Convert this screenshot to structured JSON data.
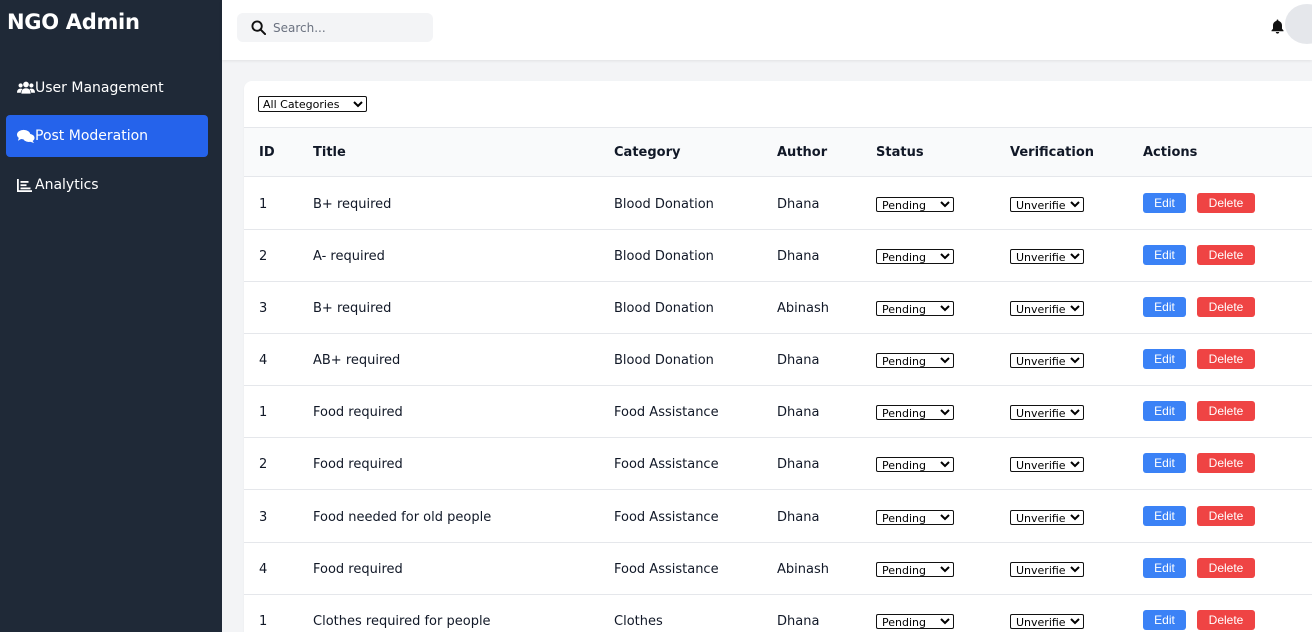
{
  "app": {
    "title": "NGO Admin"
  },
  "sidebar": {
    "items": [
      {
        "label": "User Management",
        "icon": "users-icon",
        "active": false
      },
      {
        "label": "Post Moderation",
        "icon": "comments-icon",
        "active": true
      },
      {
        "label": "Analytics",
        "icon": "chart-icon",
        "active": false
      }
    ]
  },
  "topbar": {
    "search_placeholder": "Search...",
    "search_value": ""
  },
  "filter": {
    "selected": "All Categories"
  },
  "table": {
    "headers": [
      "ID",
      "Title",
      "Category",
      "Author",
      "Status",
      "Verification",
      "Actions"
    ],
    "edit_label": "Edit",
    "delete_label": "Delete",
    "rows": [
      {
        "id": "1",
        "title": "B+ required",
        "category": "Blood Donation",
        "author": "Dhana",
        "status": "Pending",
        "verification": "Unverified"
      },
      {
        "id": "2",
        "title": "A- required",
        "category": "Blood Donation",
        "author": "Dhana",
        "status": "Pending",
        "verification": "Unverified"
      },
      {
        "id": "3",
        "title": "B+ required",
        "category": "Blood Donation",
        "author": "Abinash",
        "status": "Pending",
        "verification": "Unverified"
      },
      {
        "id": "4",
        "title": "AB+ required",
        "category": "Blood Donation",
        "author": "Dhana",
        "status": "Pending",
        "verification": "Unverified"
      },
      {
        "id": "1",
        "title": "Food required",
        "category": "Food Assistance",
        "author": "Dhana",
        "status": "Pending",
        "verification": "Unverified"
      },
      {
        "id": "2",
        "title": "Food required",
        "category": "Food Assistance",
        "author": "Dhana",
        "status": "Pending",
        "verification": "Unverified"
      },
      {
        "id": "3",
        "title": "Food needed for old people",
        "category": "Food Assistance",
        "author": "Dhana",
        "status": "Pending",
        "verification": "Unverified"
      },
      {
        "id": "4",
        "title": "Food required",
        "category": "Food Assistance",
        "author": "Abinash",
        "status": "Pending",
        "verification": "Unverified"
      },
      {
        "id": "1",
        "title": "Clothes required for people",
        "category": "Clothes",
        "author": "Dhana",
        "status": "Pending",
        "verification": "Unverified"
      }
    ]
  },
  "colors": {
    "sidebar_bg": "#1f2937",
    "active_item": "#2563eb",
    "edit_button": "#3b82f6",
    "delete_button": "#ef4444"
  }
}
